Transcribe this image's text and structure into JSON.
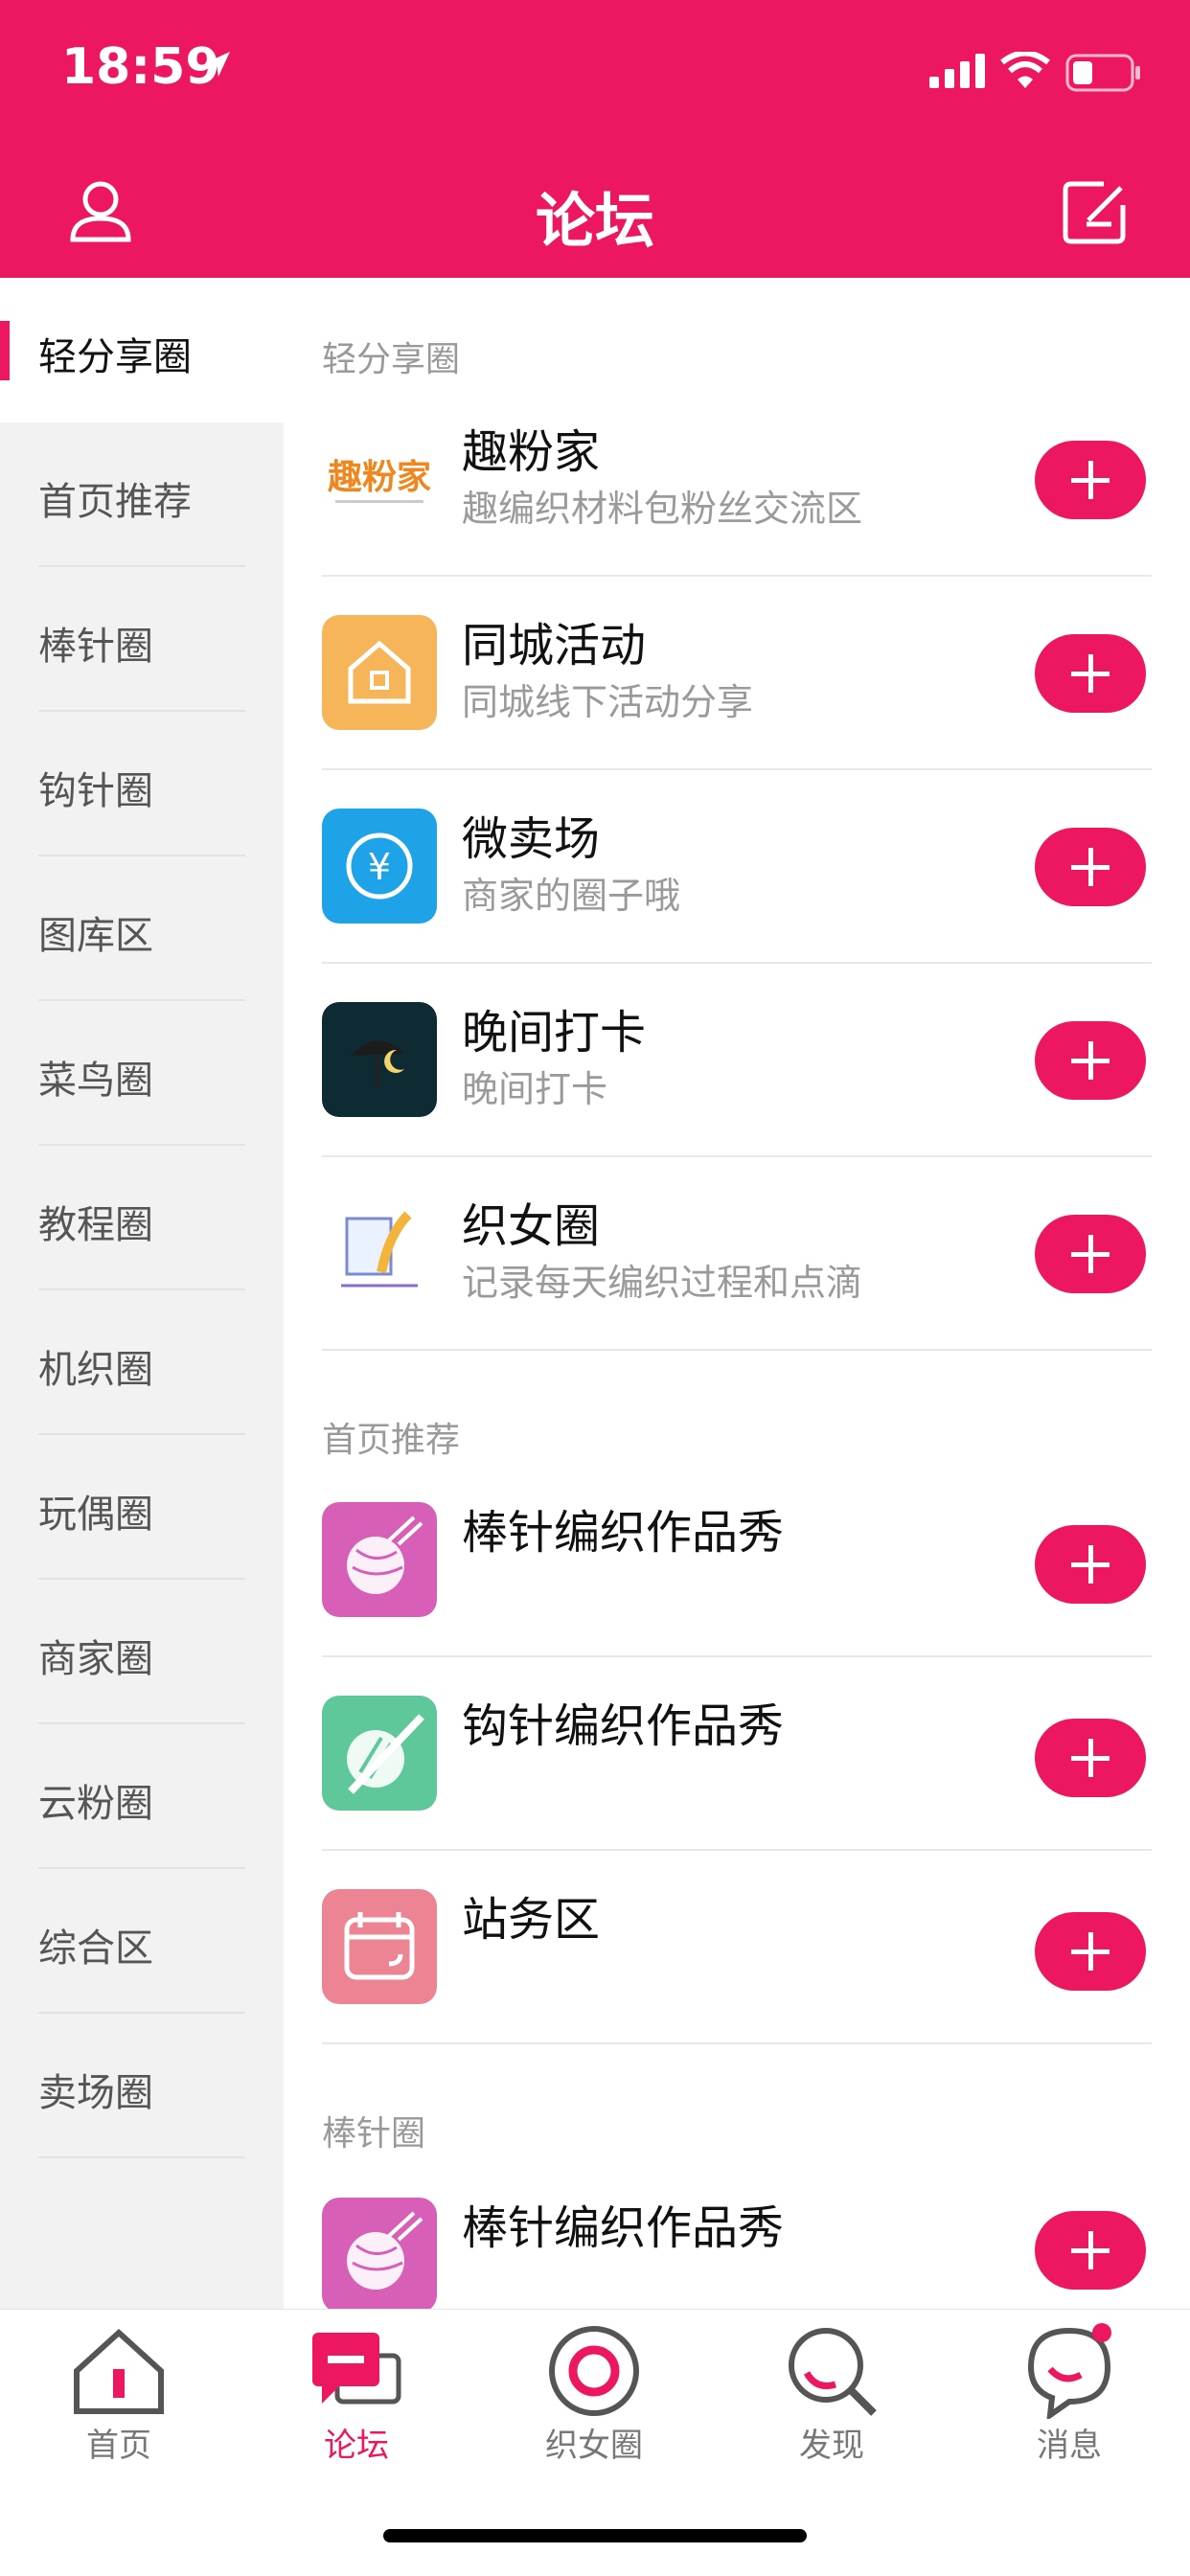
{
  "status_bar": {
    "time": "18:59"
  },
  "header": {
    "title": "论坛"
  },
  "sidebar": {
    "items": [
      {
        "label": "轻分享圈",
        "active": true
      },
      {
        "label": "首页推荐"
      },
      {
        "label": "棒针圈"
      },
      {
        "label": "钩针圈"
      },
      {
        "label": "图库区"
      },
      {
        "label": "菜鸟圈"
      },
      {
        "label": "教程圈"
      },
      {
        "label": "机织圈"
      },
      {
        "label": "玩偶圈"
      },
      {
        "label": "商家圈"
      },
      {
        "label": "云粉圈"
      },
      {
        "label": "综合区"
      },
      {
        "label": "卖场圈"
      }
    ]
  },
  "sections": [
    {
      "title": "轻分享圈",
      "items": [
        {
          "name": "趣粉家",
          "desc": "趣编织材料包粉丝交流区",
          "icon": "qufenjia-logo-icon"
        },
        {
          "name": "同城活动",
          "desc": "同城线下活动分享",
          "icon": "house-icon"
        },
        {
          "name": "微卖场",
          "desc": "商家的圈子哦",
          "icon": "yen-icon"
        },
        {
          "name": "晚间打卡",
          "desc": "晚间打卡",
          "icon": "moon-umbrella-icon"
        },
        {
          "name": "织女圈",
          "desc": "记录每天编织过程和点滴",
          "icon": "paper-feather-icon"
        }
      ]
    },
    {
      "title": "首页推荐",
      "items": [
        {
          "name": "棒针编织作品秀",
          "icon": "yarn-ball-icon"
        },
        {
          "name": "钩针编织作品秀",
          "icon": "crochet-yarn-icon"
        },
        {
          "name": "站务区",
          "icon": "calendar-icon"
        }
      ]
    },
    {
      "title": "棒针圈",
      "items": [
        {
          "name": "棒针编织作品秀",
          "icon": "yarn-ball-icon"
        }
      ]
    }
  ],
  "tabbar": {
    "items": [
      {
        "label": "首页",
        "icon": "home-icon"
      },
      {
        "label": "论坛",
        "icon": "forum-icon",
        "active": true
      },
      {
        "label": "织女圈",
        "icon": "circle-icon"
      },
      {
        "label": "发现",
        "icon": "search-icon"
      },
      {
        "label": "消息",
        "icon": "message-icon"
      }
    ]
  },
  "colors": {
    "brand": "#EC1760",
    "sidebar_bg": "#F2F2F2",
    "muted_text": "#999999"
  }
}
